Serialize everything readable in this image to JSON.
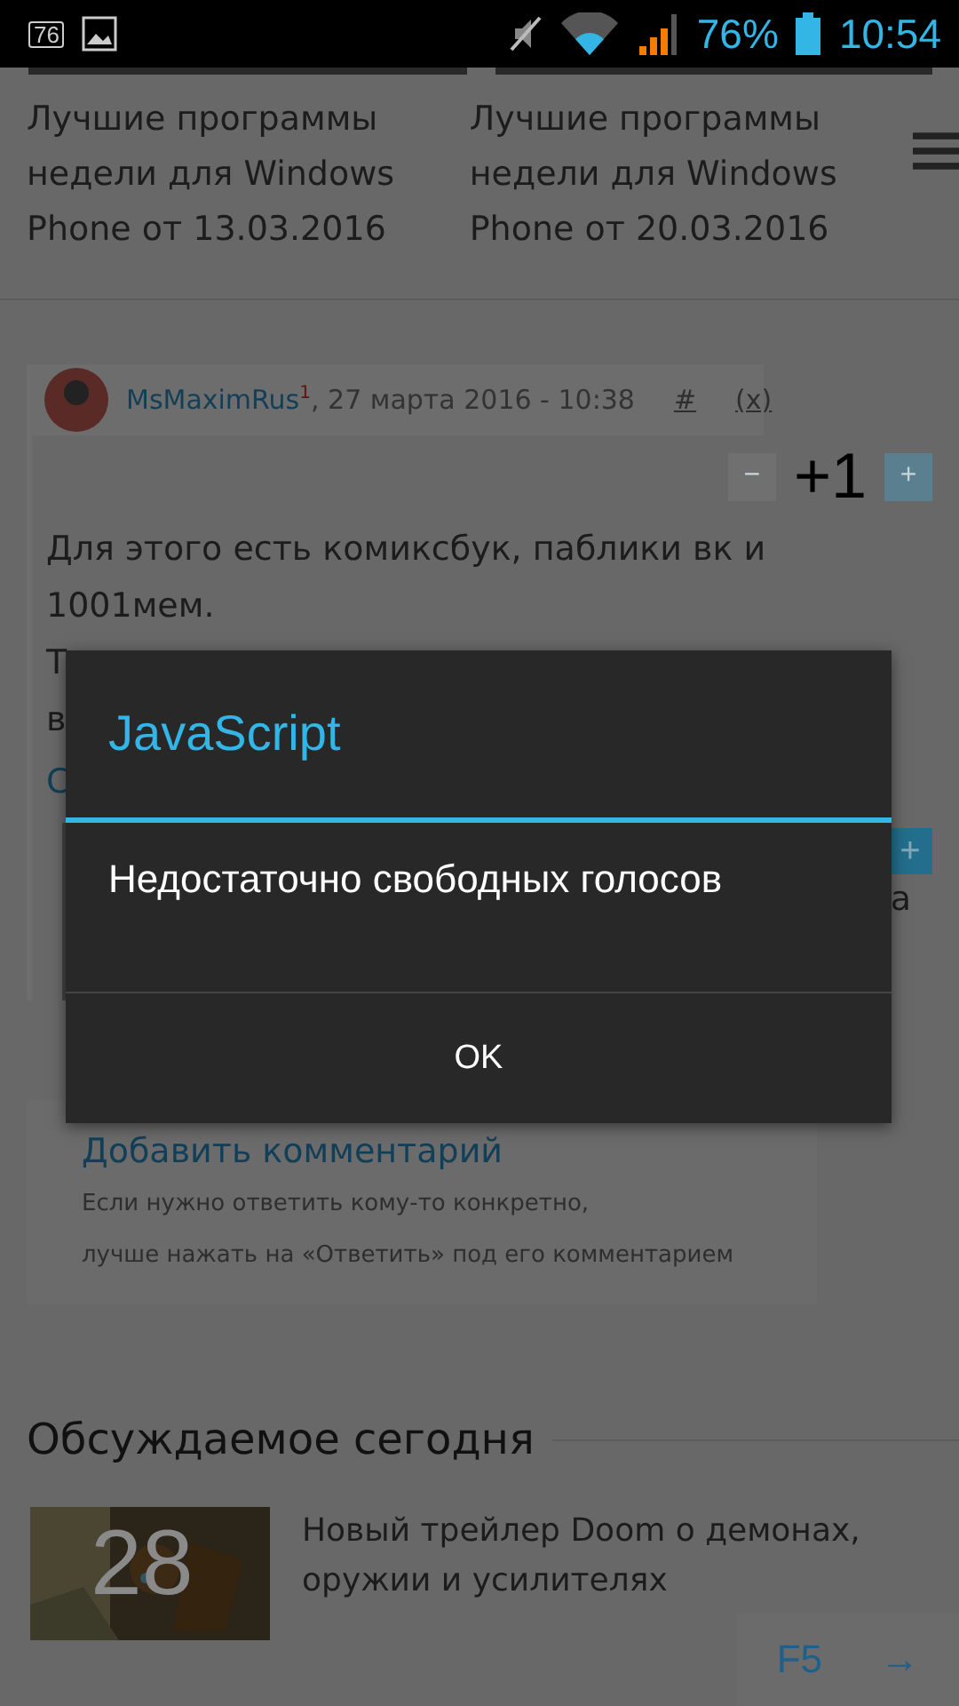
{
  "status_bar": {
    "notification_badge": "76",
    "battery_percent": "76%",
    "time": "10:54"
  },
  "top_articles": [
    {
      "title": "Лучшие программы недели для Windows Phone от 13.03.2016"
    },
    {
      "title": "Лучшие программы недели для Windows Phone от 20.03.2016"
    }
  ],
  "comment": {
    "author": "MsMaximRus",
    "author_mark": "1",
    "date": ", 27 марта 2016 - 10:38",
    "anchor": "#",
    "remove": "(x)",
    "vote_minus": "−",
    "score": "+1",
    "vote_plus": "+",
    "text_lines": [
      "Для этого есть комиксбук, паблики вк и",
      "1001мем.",
      "Т",
      "в"
    ],
    "link_fragment": "С"
  },
  "reply": {
    "plus": "+",
    "text_fragment": "а"
  },
  "add_comment": {
    "link": "Добавить комментарий",
    "hint_lines": [
      "Если нужно ответить кому-то конкретно,",
      "лучше нажать на «Ответить» под его комментарием"
    ]
  },
  "discussed": {
    "heading": "Обсуждаемое сегодня",
    "items": [
      {
        "count": "28",
        "title": "Новый трейлер Doom о демонах, оружии и усилителях"
      }
    ]
  },
  "refresh": {
    "label": "F5",
    "arrow": "→"
  },
  "dialog": {
    "title": "JavaScript",
    "message": "Недостаточно свободных голосов",
    "button": "OK"
  }
}
